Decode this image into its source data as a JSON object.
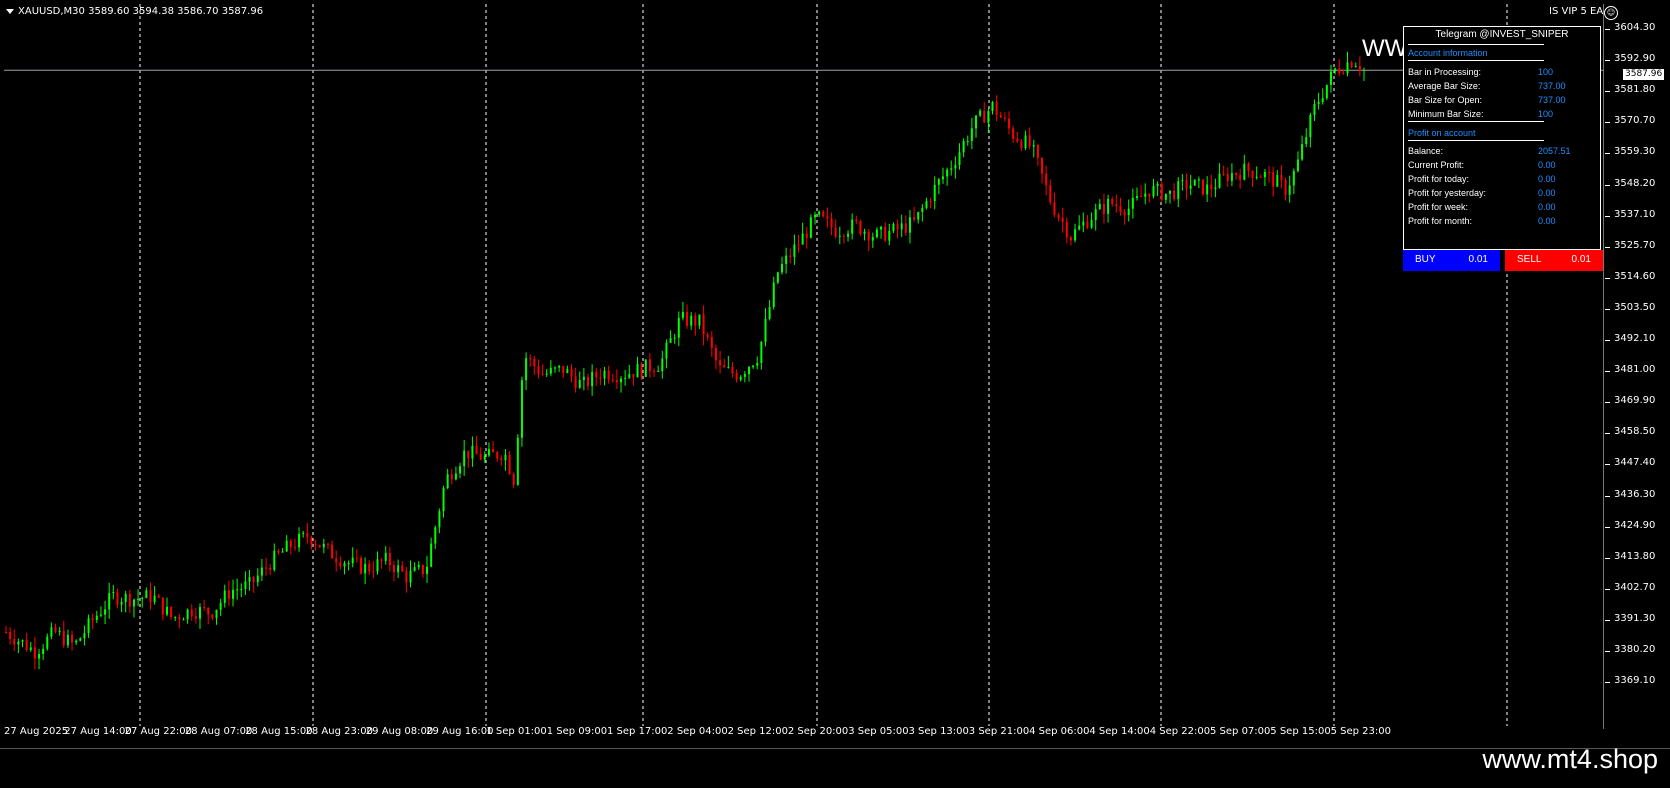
{
  "header": {
    "symbol": "XAUUSD,M30",
    "ohlc": "3589.60 3594.38 3586.70 3587.96",
    "ea_name": "IS VIP 5 EA"
  },
  "icons": {
    "menu": "triangle-down-icon",
    "smiley": "smiley-icon"
  },
  "colors": {
    "bull": "#00ff00",
    "bear": "#ff0000",
    "grid": "#ffffff",
    "background": "#000000",
    "panel_value": "#1e90ff",
    "buy": "#0000ff",
    "sell": "#ff0000"
  },
  "current_price": "3587.96",
  "overlay_text": "WW",
  "price_axis": [
    "3604.30",
    "3592.90",
    "3581.80",
    "3570.70",
    "3559.30",
    "3548.20",
    "3537.10",
    "3525.70",
    "3514.60",
    "3503.50",
    "3492.10",
    "3481.00",
    "3469.90",
    "3458.50",
    "3447.40",
    "3436.30",
    "3424.90",
    "3413.80",
    "3402.70",
    "3391.30",
    "3380.20",
    "3369.10"
  ],
  "time_axis": [
    "27 Aug 2025",
    "27 Aug 14:00",
    "27 Aug 22:00",
    "28 Aug 07:00",
    "28 Aug 15:00",
    "28 Aug 23:00",
    "29 Aug 08:00",
    "29 Aug 16:00",
    "1 Sep 01:00",
    "1 Sep 09:00",
    "1 Sep 17:00",
    "2 Sep 04:00",
    "2 Sep 12:00",
    "2 Sep 20:00",
    "3 Sep 05:00",
    "3 Sep 13:00",
    "3 Sep 21:00",
    "4 Sep 06:00",
    "4 Sep 14:00",
    "4 Sep 22:00",
    "5 Sep 07:00",
    "5 Sep 15:00",
    "5 Sep 23:00"
  ],
  "chart_data": {
    "type": "candlestick",
    "symbol": "XAUUSD",
    "timeframe": "M30",
    "ylim": [
      3369.1,
      3604.3
    ],
    "close_path": [
      [
        0,
        3385
      ],
      [
        3,
        3378
      ],
      [
        5,
        3385
      ],
      [
        7,
        3380
      ],
      [
        9,
        3390
      ],
      [
        11,
        3398
      ],
      [
        13,
        3397
      ],
      [
        15,
        3398
      ],
      [
        17,
        3390
      ],
      [
        19,
        3393
      ],
      [
        21,
        3392
      ],
      [
        23,
        3400
      ],
      [
        25,
        3402
      ],
      [
        27,
        3410
      ],
      [
        29,
        3416
      ],
      [
        31,
        3420
      ],
      [
        33,
        3414
      ],
      [
        35,
        3410
      ],
      [
        37,
        3408
      ],
      [
        39,
        3411
      ],
      [
        41,
        3405
      ],
      [
        43,
        3408
      ],
      [
        45,
        3440
      ],
      [
        47,
        3450
      ],
      [
        49,
        3448
      ],
      [
        51,
        3450
      ],
      [
        52,
        3440
      ],
      [
        53,
        3485
      ],
      [
        55,
        3478
      ],
      [
        57,
        3480
      ],
      [
        59,
        3474
      ],
      [
        61,
        3479
      ],
      [
        63,
        3478
      ],
      [
        65,
        3480
      ],
      [
        67,
        3482
      ],
      [
        69,
        3498
      ],
      [
        71,
        3497
      ],
      [
        73,
        3480
      ],
      [
        75,
        3478
      ],
      [
        77,
        3485
      ],
      [
        79,
        3515
      ],
      [
        81,
        3525
      ],
      [
        83,
        3535
      ],
      [
        85,
        3530
      ],
      [
        87,
        3532
      ],
      [
        89,
        3528
      ],
      [
        91,
        3530
      ],
      [
        93,
        3533
      ],
      [
        95,
        3545
      ],
      [
        97,
        3555
      ],
      [
        99,
        3568
      ],
      [
        101,
        3575
      ],
      [
        103,
        3565
      ],
      [
        105,
        3560
      ],
      [
        107,
        3540
      ],
      [
        109,
        3528
      ],
      [
        111,
        3535
      ],
      [
        113,
        3540
      ],
      [
        115,
        3538
      ],
      [
        117,
        3545
      ],
      [
        119,
        3543
      ],
      [
        121,
        3547
      ],
      [
        123,
        3545
      ],
      [
        125,
        3550
      ],
      [
        127,
        3552
      ],
      [
        129,
        3550
      ],
      [
        131,
        3545
      ],
      [
        132,
        3552
      ],
      [
        134,
        3575
      ],
      [
        136,
        3588
      ],
      [
        138,
        3592
      ],
      [
        139,
        3588
      ]
    ]
  },
  "panel": {
    "title": "Telegram @INVEST_SNIPER",
    "section_account": "Account information",
    "rows_account": [
      {
        "label": "Bar in Processing:",
        "value": "100"
      },
      {
        "label": "Average Bar Size:",
        "value": "737.00"
      },
      {
        "label": "Bar Size for Open:",
        "value": "737.00"
      },
      {
        "label": "Minimum Bar Size:",
        "value": "100"
      }
    ],
    "section_profit": "Profit on account",
    "rows_profit": [
      {
        "label": "Balance:",
        "value": "2057.51"
      },
      {
        "label": "Current Profit:",
        "value": "0.00"
      },
      {
        "label": "Profit for today:",
        "value": "0.00"
      },
      {
        "label": "Profit for yesterday:",
        "value": "0.00"
      },
      {
        "label": "Profit for week:",
        "value": "0.00"
      },
      {
        "label": "Profit for month:",
        "value": "0.00"
      }
    ]
  },
  "trade": {
    "buy_label": "BUY",
    "buy_lot": "0.01",
    "sell_label": "SELL",
    "sell_lot": "0.01"
  },
  "watermark": "www.mt4.shop"
}
